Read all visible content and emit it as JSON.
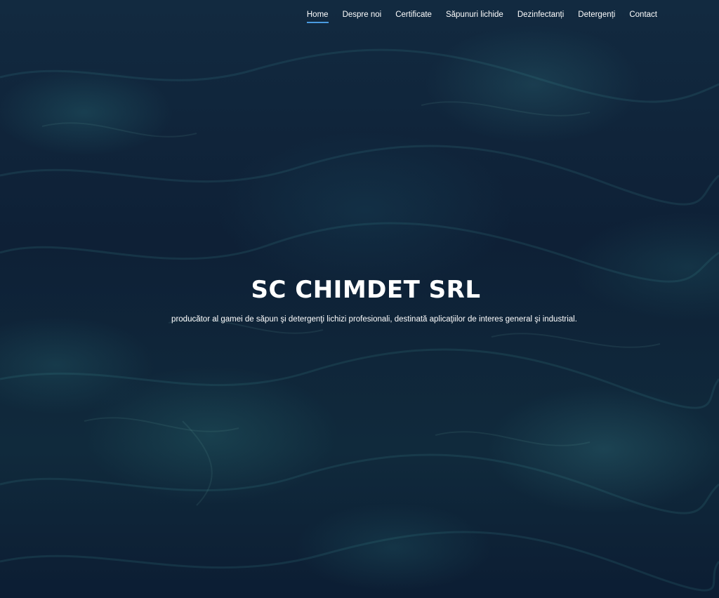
{
  "nav": {
    "items": [
      {
        "label": "Home",
        "active": true
      },
      {
        "label": "Despre noi",
        "active": false
      },
      {
        "label": "Certificate",
        "active": false
      },
      {
        "label": "Săpunuri lichide",
        "active": false
      },
      {
        "label": "Dezinfectanți",
        "active": false
      },
      {
        "label": "Detergenți",
        "active": false
      },
      {
        "label": "Contact",
        "active": false
      }
    ]
  },
  "hero": {
    "title": "SC CHIMDET SRL",
    "subtitle": "producător al gamei de săpun şi detergenţi lichizi profesionali, destinată aplicaţiilor de interes general şi industrial.",
    "background": "water-ripple-image"
  },
  "colors": {
    "background": "#0d2138",
    "text": "#ffffff",
    "active_underline": "#4a9be0"
  }
}
